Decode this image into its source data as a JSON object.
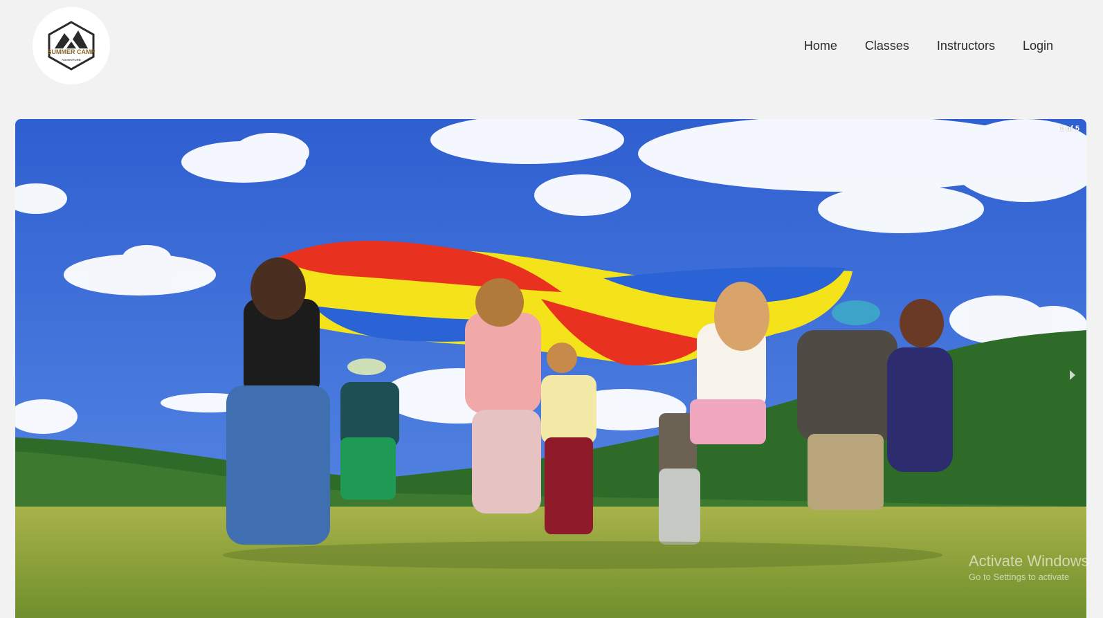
{
  "logo": {
    "icon": "summer-camp-logo",
    "title": "SUMMER CAMP",
    "subtitle": "ADVENTURE"
  },
  "nav": {
    "items": [
      {
        "label": "Home"
      },
      {
        "label": "Classes"
      },
      {
        "label": "Instructors"
      },
      {
        "label": "Login"
      }
    ]
  },
  "carousel": {
    "counter": "1 of 5",
    "current_slide": 1,
    "total_slides": 5,
    "next_icon": "chevron-right-icon",
    "slide_description_icon": "children-with-parachute-photo"
  },
  "watermark": {
    "title": "Activate Windows",
    "subtitle": "Go to Settings to activate"
  },
  "colors": {
    "page_bg": "#f2f2f2",
    "sky": "#3f6fd8",
    "grass": "#8fa83c",
    "hills": "#2f6a2a",
    "parachute_red": "#e8321f",
    "parachute_yellow": "#f4e21a",
    "parachute_blue": "#2a63d6"
  }
}
